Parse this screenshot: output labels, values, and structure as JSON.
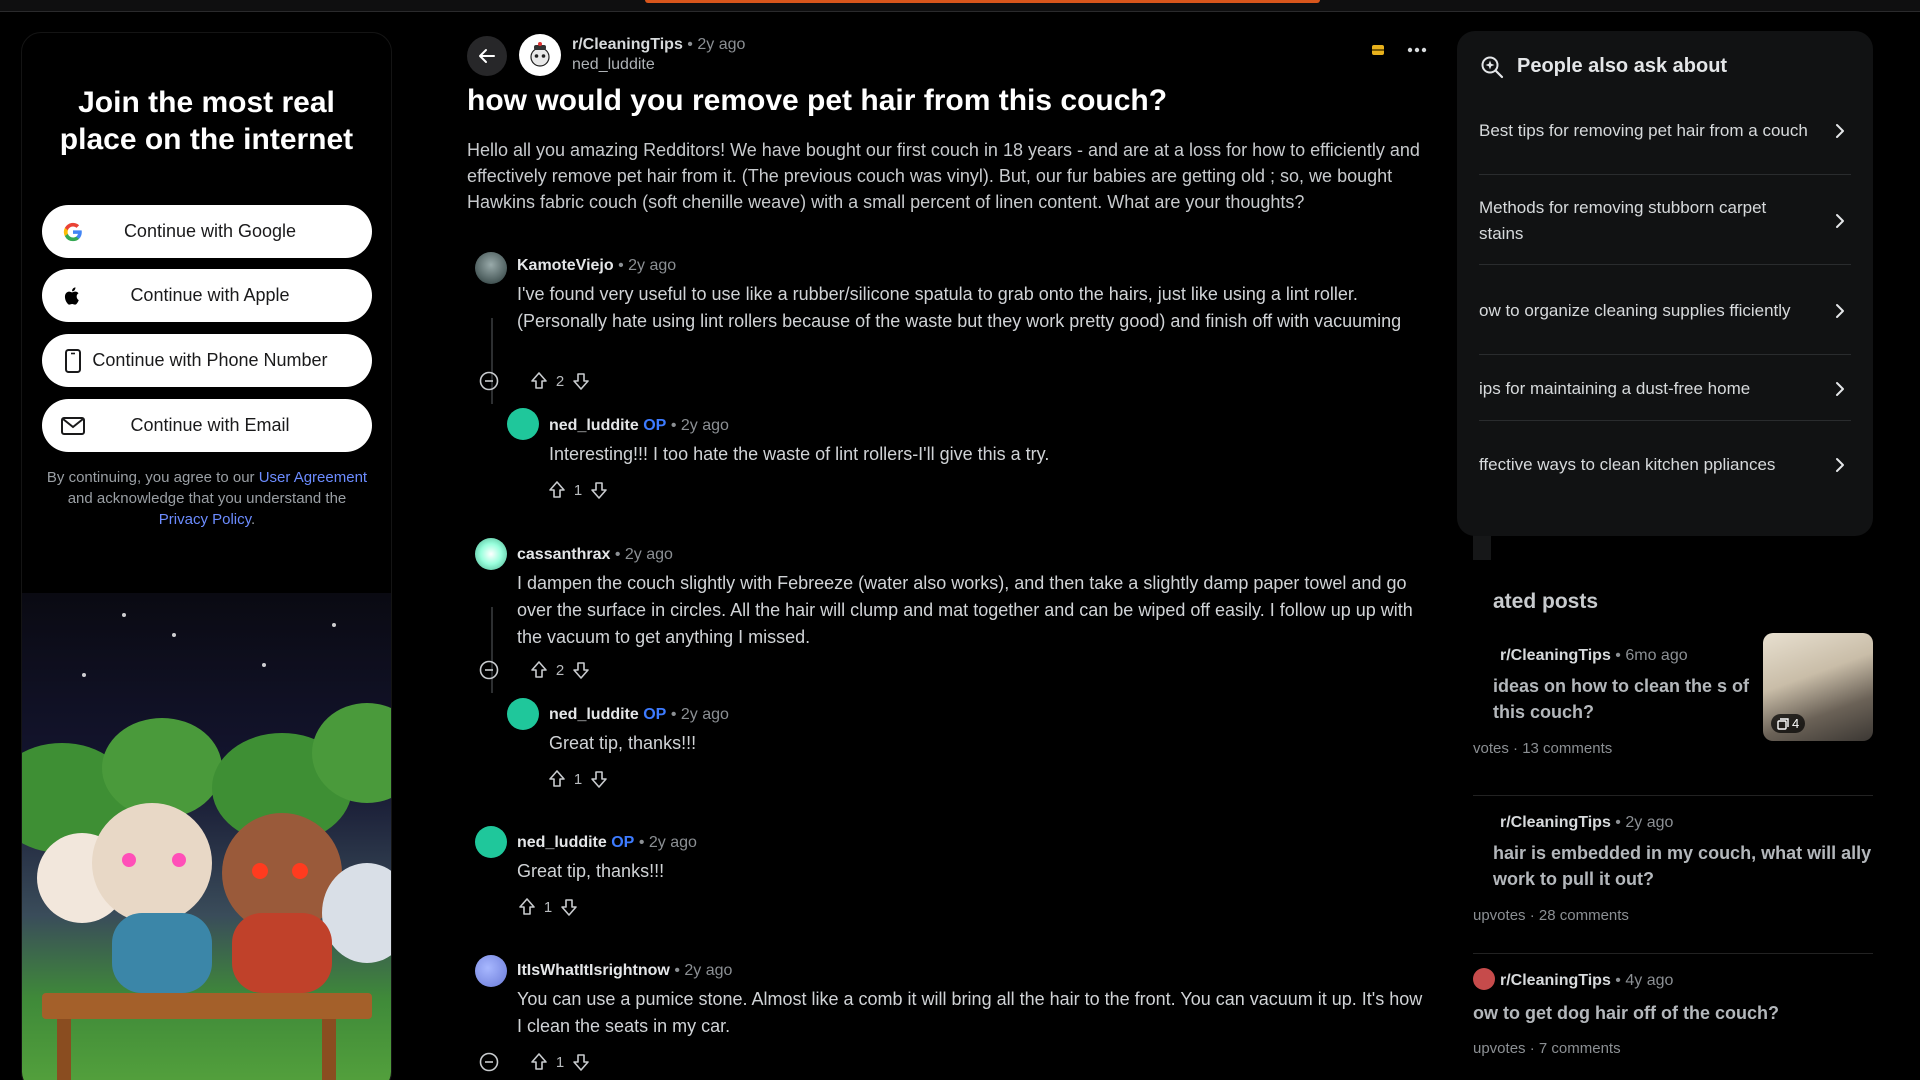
{
  "signup": {
    "title": "Join the most real place on the internet",
    "google": "Continue with Google",
    "apple": "Continue with Apple",
    "phone": "Continue with Phone Number",
    "email": "Continue with Email",
    "legal_pre": "By continuing, you agree to our",
    "legal_ua": "User Agreement",
    "legal_mid": "and acknowledge that you understand the",
    "legal_pp": "Privacy Policy",
    "legal_end": "."
  },
  "post": {
    "subreddit": "r/CleaningTips",
    "time": "2y ago",
    "author": "ned_luddite",
    "title": "how would you remove pet hair from this couch?",
    "body": "Hello all you amazing Redditors! We have bought our first couch in 18 years - and are at a loss for how to efficiently and effectively remove pet hair from it. (The previous couch was vinyl). But, our fur babies are getting old ; so, we bought Hawkins fabric couch (soft chenille weave) with a small percent of linen content. What are your thoughts?"
  },
  "comments": [
    {
      "user": "KamoteViejo",
      "op": "",
      "time": "2y ago",
      "text": "I've found very useful to use like a rubber/silicone spatula to grab onto the hairs, just like using a lint roller. (Personally hate using lint rollers because of the waste but they work pretty good) and finish off with vacuuming",
      "score": "2"
    },
    {
      "user": "ned_luddite",
      "op": "OP",
      "time": "2y ago",
      "text": "Interesting!!! I too hate the waste of lint rollers-I'll give this a try.",
      "score": "1"
    },
    {
      "user": "cassanthrax",
      "op": "",
      "time": "2y ago",
      "text": "I dampen the couch slightly with Febreeze (water also works), and then take a slightly damp paper towel and go over the surface in circles. All the hair will clump and mat together and can be wiped off easily. I follow up up with the vacuum to get anything I missed.",
      "score": "2"
    },
    {
      "user": "ned_luddite",
      "op": "OP",
      "time": "2y ago",
      "text": "Great tip, thanks!!!",
      "score": "1"
    },
    {
      "user": "ned_luddite",
      "op": "OP",
      "time": "2y ago",
      "text": "Great tip, thanks!!!",
      "score": "1"
    },
    {
      "user": "ItIsWhatItIsrightnow",
      "op": "",
      "time": "2y ago",
      "text": "You can use a pumice stone. Almost like a comb it will bring all the hair to the front. You can vacuum it up. It's how I clean the seats in my car.",
      "score": "1"
    }
  ],
  "paa": {
    "title": "People also ask about",
    "items": [
      "Best tips for removing pet hair from a couch",
      "Methods for removing stubborn carpet stains",
      "ow to organize cleaning supplies fficiently",
      "ips for maintaining a dust-free home",
      "ffective ways to clean kitchen ppliances"
    ]
  },
  "related": {
    "title": "ated posts",
    "items": [
      {
        "sub": "r/CleaningTips",
        "time": "6mo ago",
        "title": "ideas on how to clean the s of this couch?",
        "votes": "votes",
        "comments": "13 comments",
        "thumb_count": "4"
      },
      {
        "sub": "r/CleaningTips",
        "time": "2y ago",
        "title": "hair is embedded in my couch, what will ally work to pull it out?",
        "votes": "upvotes",
        "comments": "28 comments"
      },
      {
        "sub": "r/CleaningTips",
        "time": "4y ago",
        "title": "ow to get dog hair off of the couch?",
        "votes": "upvotes",
        "comments": "7 comments"
      }
    ]
  },
  "colors": {
    "background": "#000000",
    "op_badge": "#3d7bff",
    "link": "#6c8cff",
    "orange_accent": "#d9561c"
  }
}
